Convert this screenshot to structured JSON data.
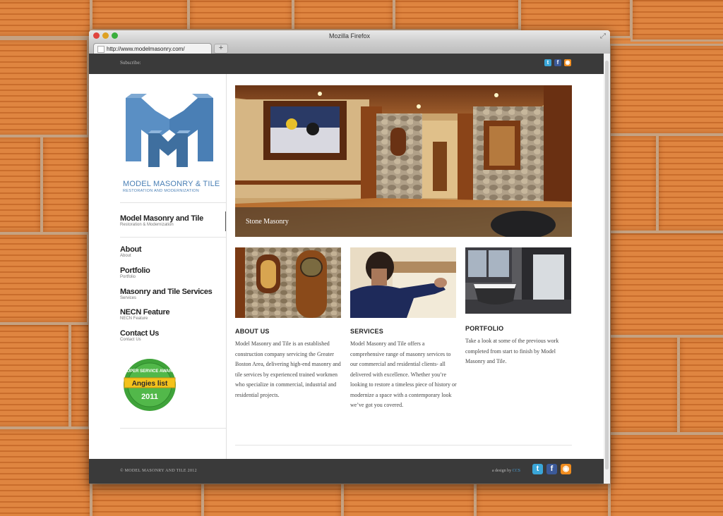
{
  "browser": {
    "window_title": "Mozilla Firefox",
    "tab_url": "http://www.modelmasonry.com/",
    "new_tab": "+"
  },
  "topbar": {
    "subscribe": "Subscribe:",
    "icons": [
      "twitter-icon",
      "facebook-icon",
      "rss-icon"
    ]
  },
  "logo": {
    "name": "MODEL MASONRY & TILE",
    "tagline": "RESTORATION AND MODERNIZATION"
  },
  "nav": [
    {
      "title": "Model Masonry and Tile",
      "sub": "Restoration & Modernization"
    },
    {
      "title": "About",
      "sub": "About"
    },
    {
      "title": "Portfolio",
      "sub": "Portfolio"
    },
    {
      "title": "Masonry and Tile Services",
      "sub": "Services"
    },
    {
      "title": "NECN Feature",
      "sub": "NECN Feature"
    },
    {
      "title": "Contact Us",
      "sub": "Contact Us"
    }
  ],
  "badge": {
    "top": "SUPER SERVICE AWARD",
    "brand": "Angies list",
    "year": "2011"
  },
  "hero": {
    "caption": "Stone Masonry"
  },
  "sections": [
    {
      "heading": "ABOUT US",
      "text": "Model Masonry and Tile is an established construction company servicing the Greater Boston Area, delivering high-end masonry and tile services by experienced trained workmen who specialize in commercial, industrial and residential projects."
    },
    {
      "heading": "SERVICES",
      "text": "Model Masonry and Tile offers a comprehensive range of masonry services to our commercial and residential clients- all delivered with excellence. Whether you’re looking to restore a timeless piece of history or modernize a space with a contemporary look we’ve got you covered."
    },
    {
      "heading": "PORTFOLIO",
      "text": "Take a look at some of the previous work completed from start to finish by Model Masonry and Tile."
    }
  ],
  "footer": {
    "copyright": "© MODEL MASONRY AND TILE 2012",
    "design_prefix": "a design by",
    "design_by": "CCS"
  },
  "colors": {
    "brand_blue": "#4a7fb5",
    "dark_bar": "#3a3a3a"
  }
}
